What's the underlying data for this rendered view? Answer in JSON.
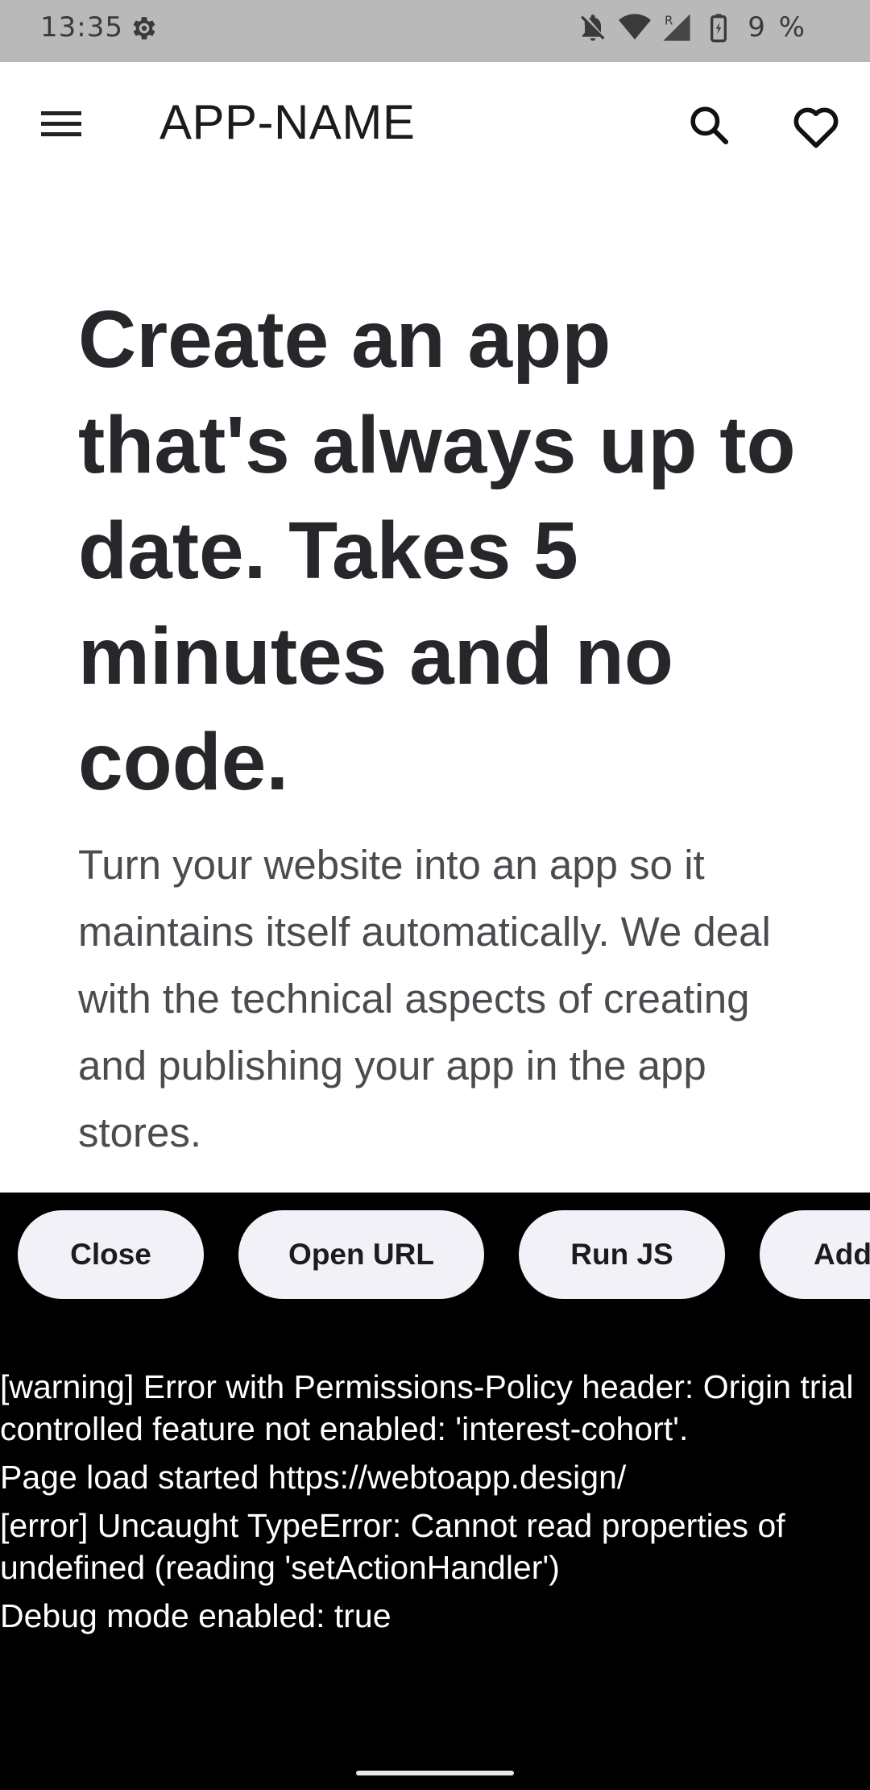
{
  "status_bar": {
    "time": "13:35",
    "battery_percent": "9 %",
    "icons": [
      "settings-gear-icon",
      "notifications-muted-icon",
      "wifi-icon",
      "signal-roaming-icon",
      "battery-charging-icon"
    ]
  },
  "app_bar": {
    "title": "APP-NAME",
    "icons": [
      "menu-icon",
      "search-icon",
      "heart-icon"
    ]
  },
  "web_content": {
    "headline": "Create an app that's always up to date. Takes 5 minutes and no code.",
    "subtitle": "Turn your website into an app so it maintains itself automatically. We deal with the technical aspects of creating and publishing your app in the app stores."
  },
  "debug_panel": {
    "buttons": [
      {
        "label": "Close"
      },
      {
        "label": "Open URL"
      },
      {
        "label": "Run JS"
      },
      {
        "label": "Add"
      }
    ],
    "log_lines": [
      "[warning] Error with Permissions-Policy header: Origin trial controlled feature not enabled: 'interest-cohort'.",
      "Page load started https://webtoapp.design/",
      "[error] Uncaught TypeError: Cannot read properties of undefined (reading 'setActionHandler')",
      "Debug mode enabled: true"
    ]
  },
  "colors": {
    "status_bar_bg": "#b9b9b9",
    "app_bar_bg": "#ffffff",
    "headline_text": "#25272b",
    "debug_bg": "#000000",
    "pill_bg": "#f2f1f7"
  }
}
